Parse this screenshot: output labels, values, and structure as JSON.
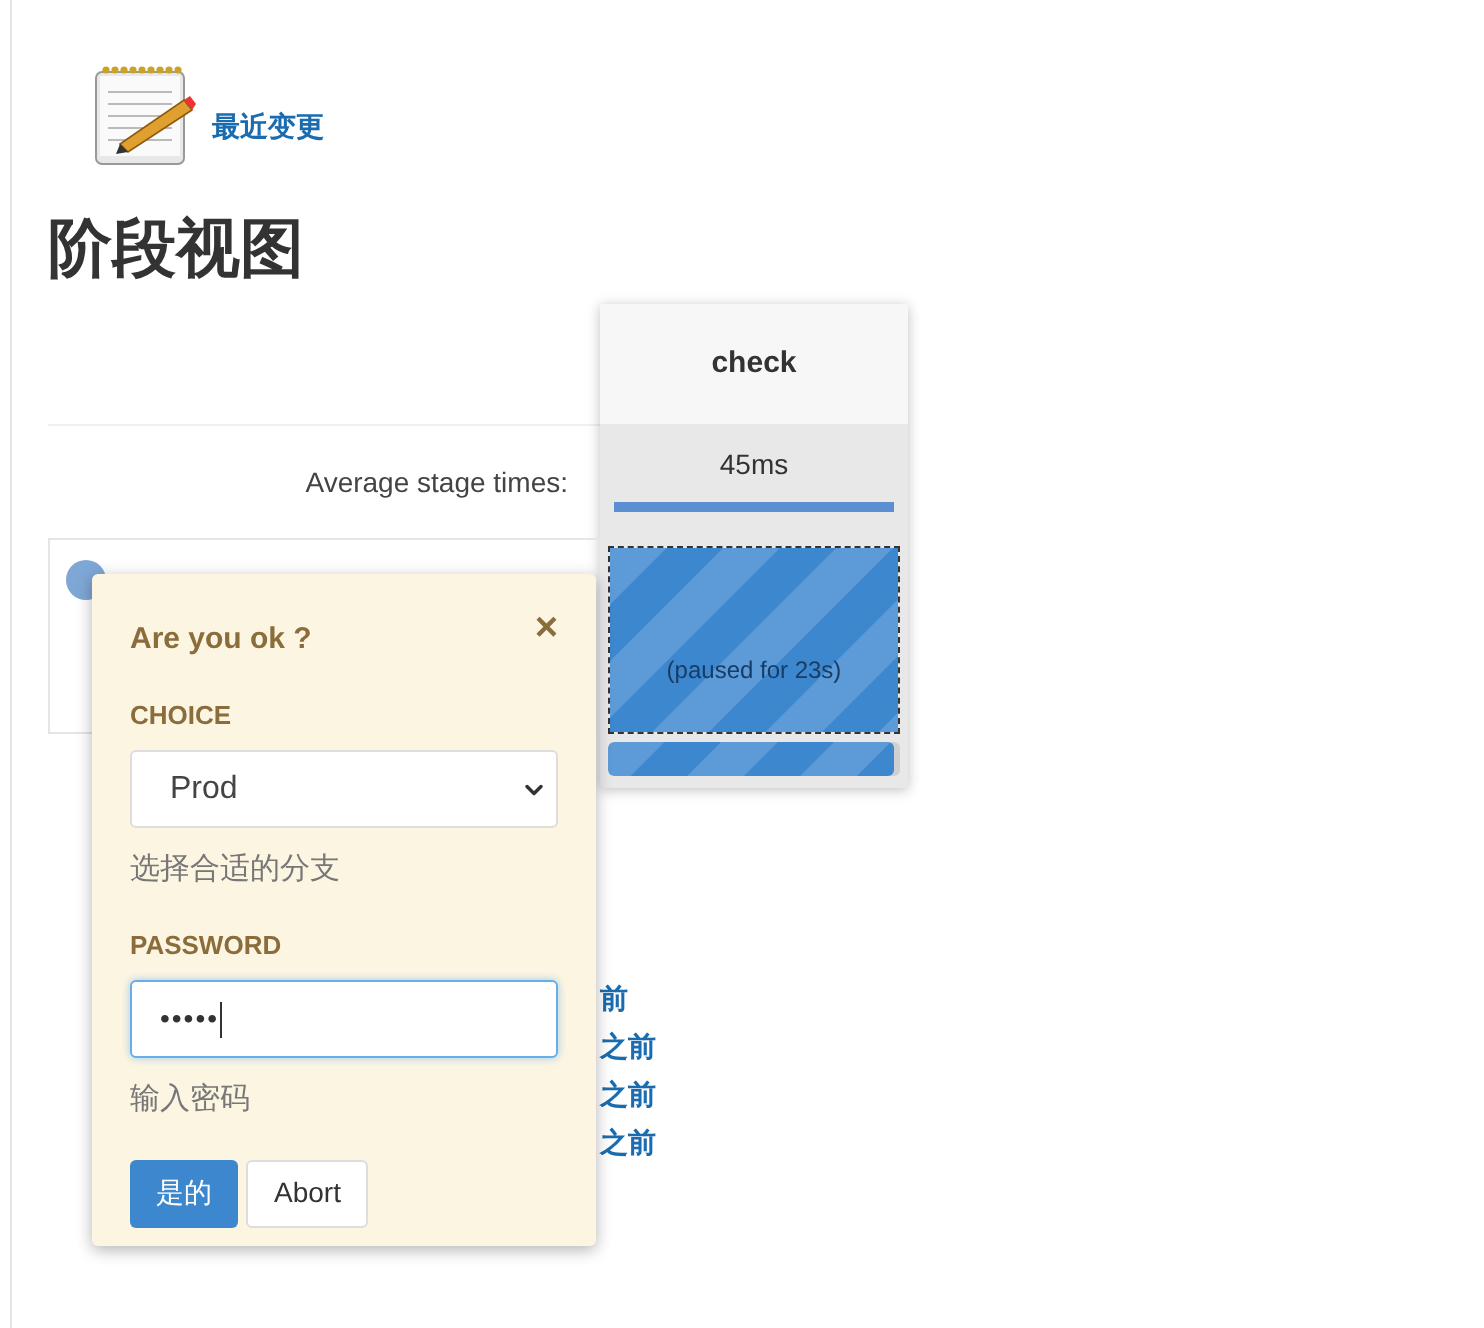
{
  "recent_changes": {
    "label": "最近变更"
  },
  "stage_view": {
    "heading": "阶段视图",
    "average_label": "Average stage times:",
    "stages": [
      {
        "name": "check",
        "average": "45ms",
        "level": 1
      }
    ],
    "builds": [
      {
        "cells": [
          {
            "kind": "paused",
            "text": "(paused for 23s)",
            "level": 0.98
          }
        ]
      }
    ]
  },
  "links": [
    "前",
    "之前",
    "之前",
    "之前"
  ],
  "dialog": {
    "title": "Are you ok ?",
    "close": "×",
    "fields": [
      {
        "kind": "select",
        "label": "CHOICE",
        "value": "Prod",
        "help": "选择合适的分支"
      },
      {
        "kind": "password",
        "label": "PASSWORD",
        "value": "•••••",
        "help": "输入密码",
        "focused": true
      }
    ],
    "buttons": [
      {
        "label": "是的",
        "primary": true
      },
      {
        "label": "Abort",
        "primary": false
      }
    ]
  }
}
